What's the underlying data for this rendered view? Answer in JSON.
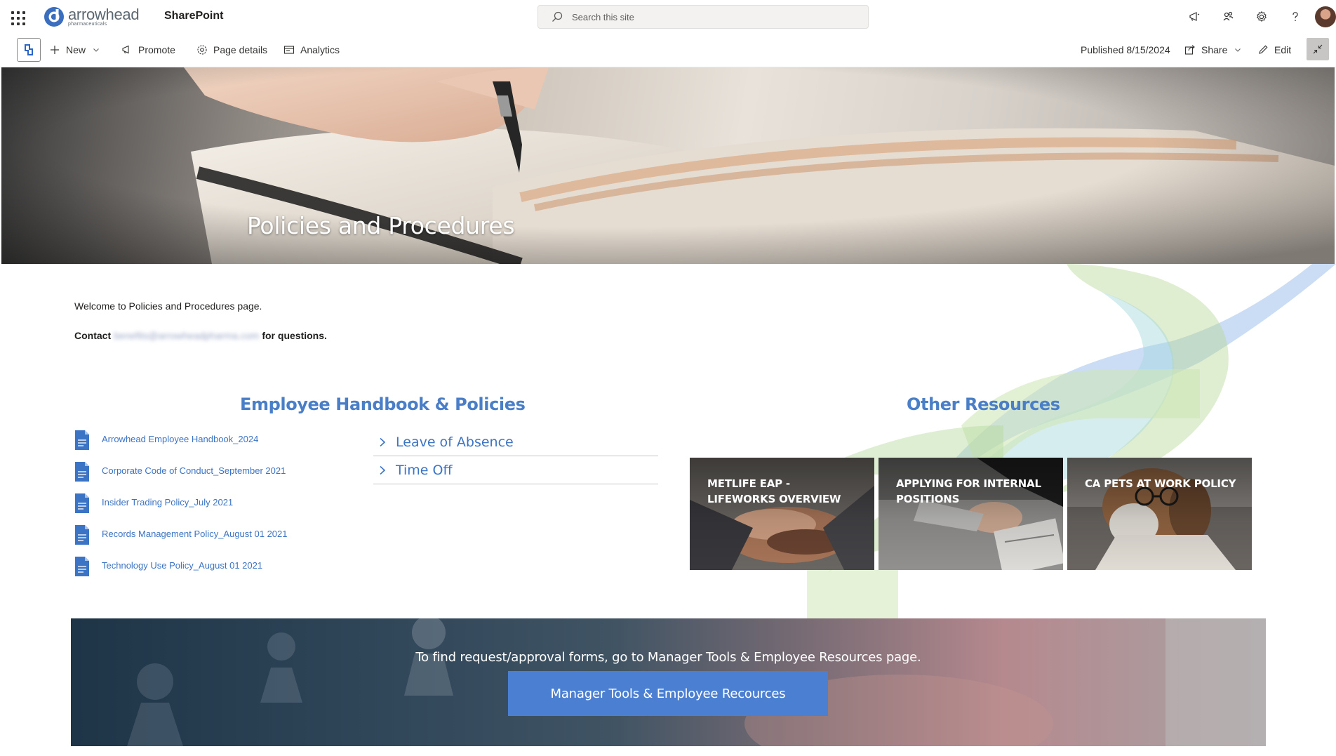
{
  "suite": {
    "brand_name": "arrowhead",
    "brand_sub": "pharmaceuticals",
    "app_name": "SharePoint",
    "search_placeholder": "Search this site",
    "icons": [
      "waffle-icon",
      "megaphone-icon",
      "people-icon",
      "gear-icon",
      "help-icon"
    ]
  },
  "commandbar": {
    "new_label": "New",
    "promote_label": "Promote",
    "page_details_label": "Page details",
    "analytics_label": "Analytics",
    "published_label": "Published 8/15/2024",
    "share_label": "Share",
    "edit_label": "Edit"
  },
  "hero": {
    "title": "Policies and Procedures"
  },
  "intro": {
    "welcome": "Welcome to Policies and Procedures page.",
    "contact_prefix": "Contact",
    "contact_email": "benefits@arrowheadpharma.com",
    "contact_suffix": "for questions."
  },
  "handbook": {
    "title": "Employee Handbook & Policies",
    "documents": [
      {
        "label": "Arrowhead Employee Handbook_2024"
      },
      {
        "label": "Corporate Code of Conduct_September 2021"
      },
      {
        "label": "Insider Trading Policy_July 2021"
      },
      {
        "label": "Records Management Policy_August 01 2021"
      },
      {
        "label": "Technology Use Policy_August 01 2021"
      }
    ],
    "accordion": [
      {
        "label": "Leave of Absence"
      },
      {
        "label": "Time Off"
      }
    ]
  },
  "resources": {
    "title": "Other Resources",
    "tiles": [
      {
        "label": "METLIFE EAP - LIFEWORKS OVERVIEW"
      },
      {
        "label": "APPLYING FOR INTERNAL POSITIONS"
      },
      {
        "label": "CA PETS AT WORK POLICY"
      }
    ]
  },
  "banner": {
    "text": "To find request/approval forms, go to Manager Tools & Employee Resources page.",
    "button_label": "Manager Tools & Employee Recources"
  },
  "colors": {
    "accent": "#4a7fc8",
    "link": "#3b74c4",
    "button": "#4a7fd1"
  }
}
